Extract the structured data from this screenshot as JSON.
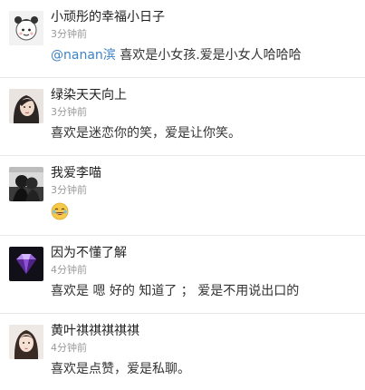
{
  "comments": [
    {
      "username": "小顽彤的幸福小日子",
      "time": "3分钟前",
      "mention": "@nanan滨",
      "content": " 喜欢是小女孩.爱是小女人哈哈哈",
      "avatar_icon": "cartoon-girl-avatar"
    },
    {
      "username": "绿染天天向上",
      "time": "3分钟前",
      "content": "喜欢是迷恋你的笑，爱是让你笑。",
      "avatar_icon": "woman-portrait-avatar"
    },
    {
      "username": "我爱李喵",
      "time": "3分钟前",
      "content_icon": "laughing-emoji",
      "avatar_icon": "couple-silhouette-avatar"
    },
    {
      "username": "因为不懂了解",
      "time": "4分钟前",
      "content": "喜欢是 嗯 好的 知道了 ； 爱是不用说出口的",
      "avatar_icon": "diamond-avatar"
    },
    {
      "username": "黄叶祺祺祺祺祺",
      "time": "4分钟前",
      "content": "喜欢是点赞，爱是私聊。",
      "avatar_icon": "girl-portrait-avatar"
    }
  ],
  "colors": {
    "mention": "#3d83c5",
    "time": "#9a9a9a",
    "divider": "#e8e8e8"
  }
}
